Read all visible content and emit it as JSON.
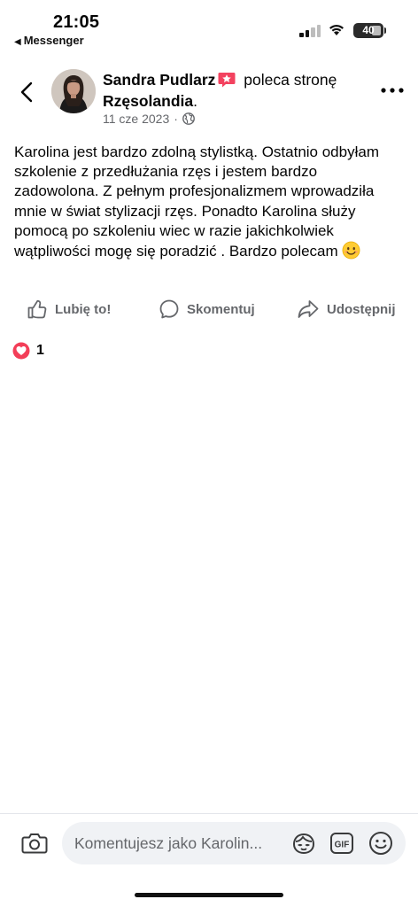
{
  "status_bar": {
    "time": "21:05",
    "back_app": "Messenger",
    "battery": "40"
  },
  "post": {
    "author": "Sandra Pudlarz",
    "action_text": "poleca stronę",
    "page_name": "Rzęsolandia",
    "page_suffix": ".",
    "date": "11 cze 2023",
    "date_separator": "·",
    "body": "Karolina jest bardzo zdolną stylistką. Ostatnio odbyłam szkolenie z przedłużania rzęs i jestem bardzo zadowolona. Z pełnym profesjonalizmem wprowadziła mnie w świat stylizacji rzęs. Ponadto Karolina służy pomocą po szkoleniu wiec w razie jakichkolwiek wątpliwości mogę się poradzić . Bardzo polecam",
    "body_emoji": "smiling-face-emoji"
  },
  "actions": {
    "like_label": "Lubię to!",
    "comment_label": "Skomentuj",
    "share_label": "Udostępnij"
  },
  "reactions": {
    "type": "love",
    "count": "1"
  },
  "composer": {
    "placeholder": "Komentujesz jako Karolin...",
    "gif_label": "GIF"
  },
  "colors": {
    "text": "#050505",
    "secondary": "#65676b",
    "recommend_badge": "#f3425f",
    "love": "#f33e58",
    "input_bg": "#f0f2f5"
  }
}
